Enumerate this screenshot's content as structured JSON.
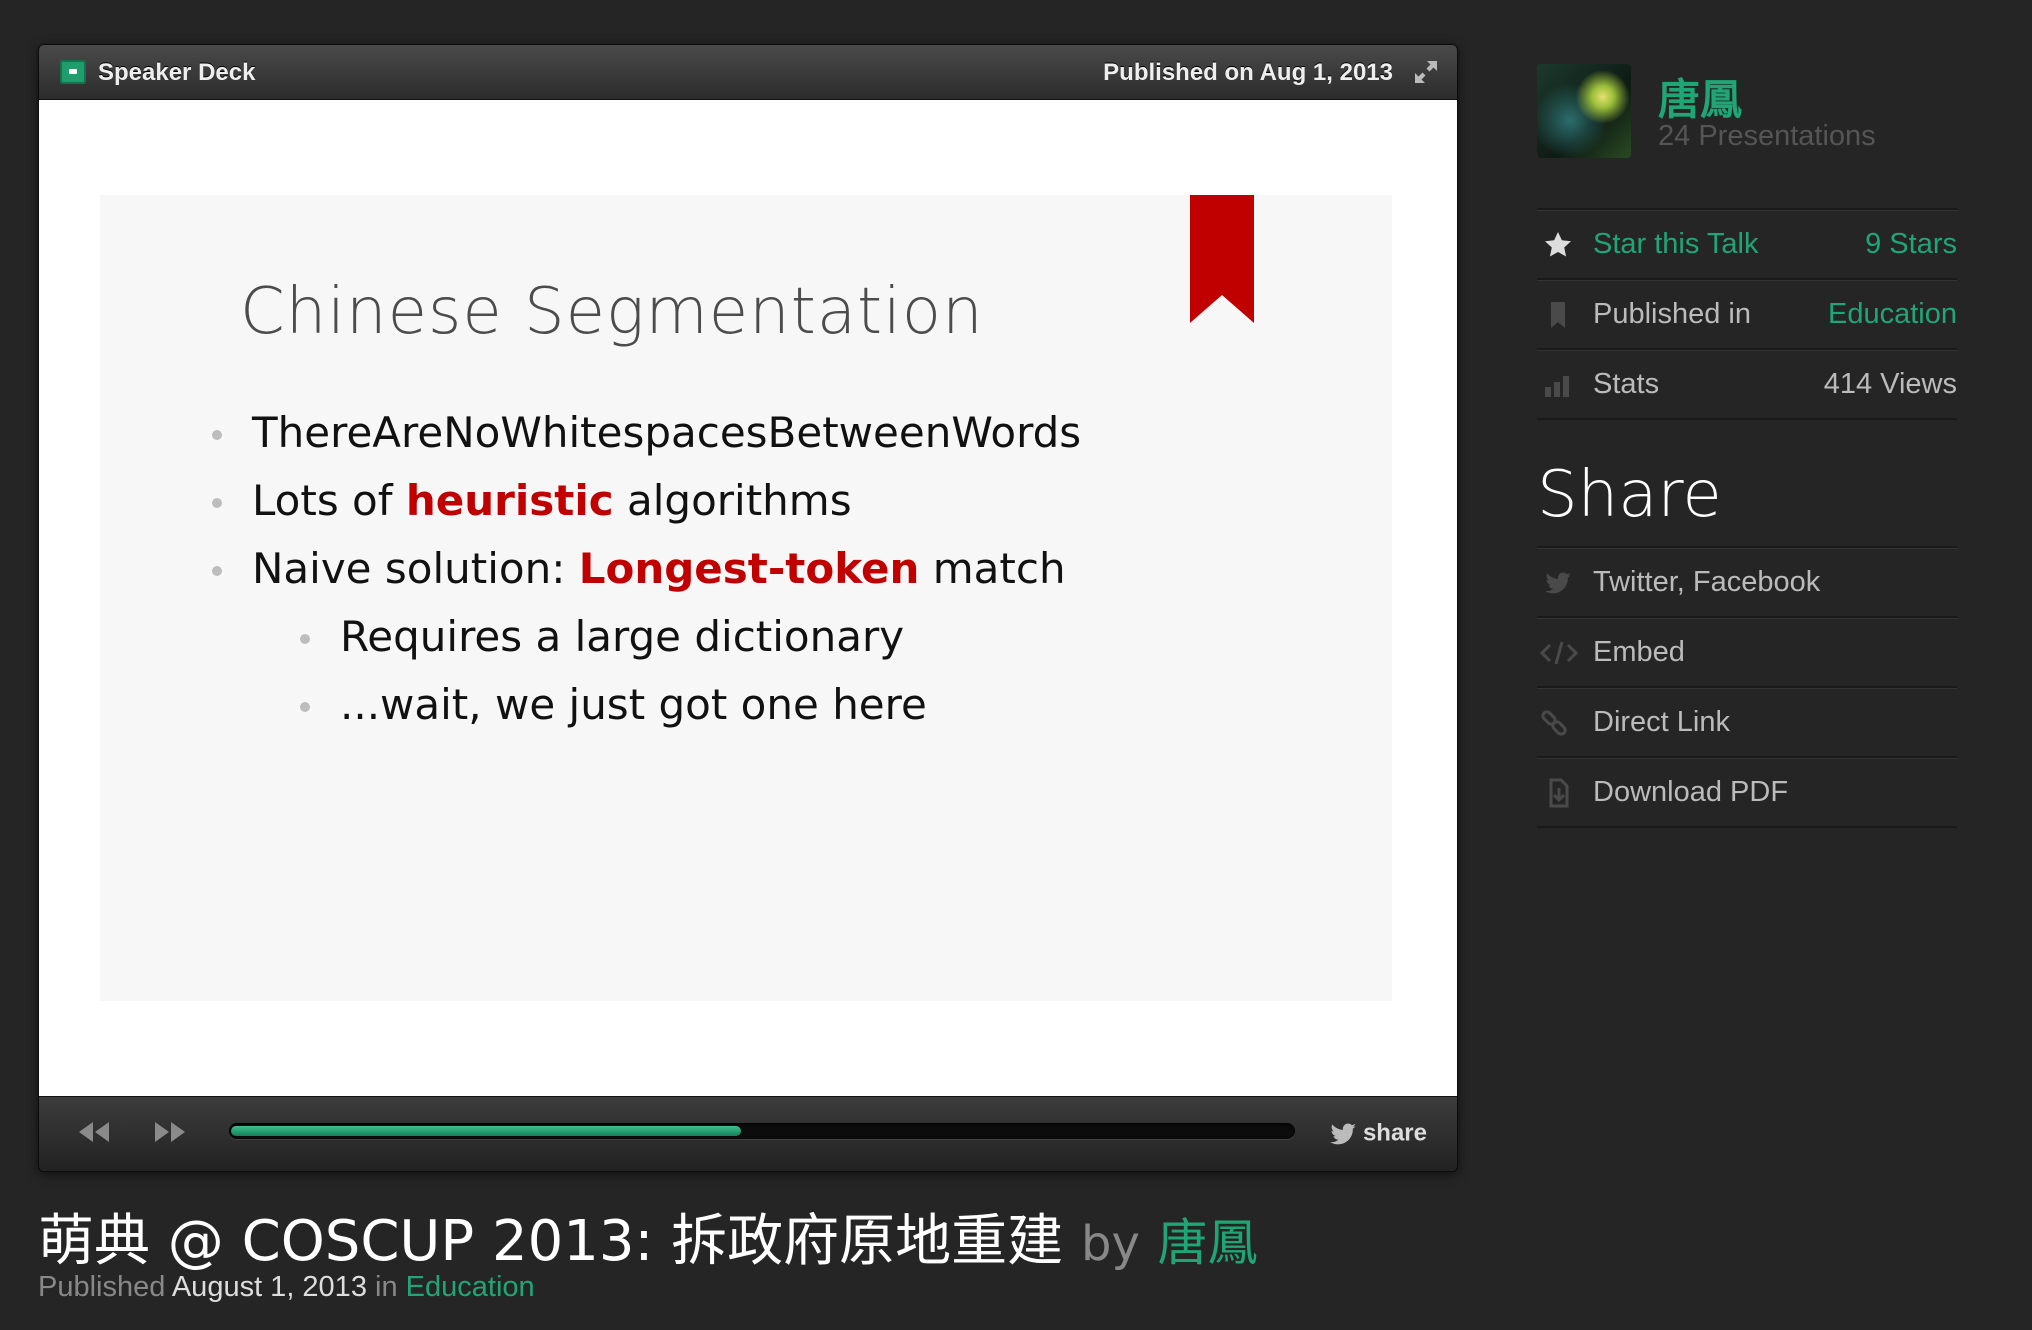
{
  "player": {
    "brand": "Speaker Deck",
    "published_label": "Published on Aug 1, 2013",
    "share_label": "share",
    "progress_fraction": 0.48
  },
  "slide": {
    "title": "Chinese Segmentation",
    "bullets": [
      {
        "parts": [
          "ThereAreNoWhitespacesBetweenWords"
        ]
      },
      {
        "before": "Lots of ",
        "highlight": "heuristic",
        "after": " algorithms"
      },
      {
        "before": "Naive solution: ",
        "highlight": "Longest-token",
        "after": " match"
      },
      {
        "text": "Requires a large dictionary"
      },
      {
        "text": "...wait, we just got one here"
      }
    ],
    "bookmark_color": "#c00000"
  },
  "talk": {
    "title": "萌典 @ COSCUP 2013: 拆政府原地重建",
    "by": "by",
    "author": "唐鳳",
    "published_prefix": "Published",
    "published_date": "August 1, 2013",
    "in": "in",
    "category": "Education"
  },
  "sidebar": {
    "author_name": "唐鳳",
    "author_count": "24 Presentations",
    "star_label": "Star this Talk",
    "star_value": "9 Stars",
    "published_in_label": "Published in",
    "published_in_value": "Education",
    "stats_label": "Stats",
    "stats_value": "414 Views",
    "share_heading": "Share",
    "share_items": [
      "Twitter, Facebook",
      "Embed",
      "Direct Link",
      "Download PDF"
    ]
  },
  "colors": {
    "accent": "#1fa676",
    "highlight": "#c00000",
    "background": "#252525"
  }
}
